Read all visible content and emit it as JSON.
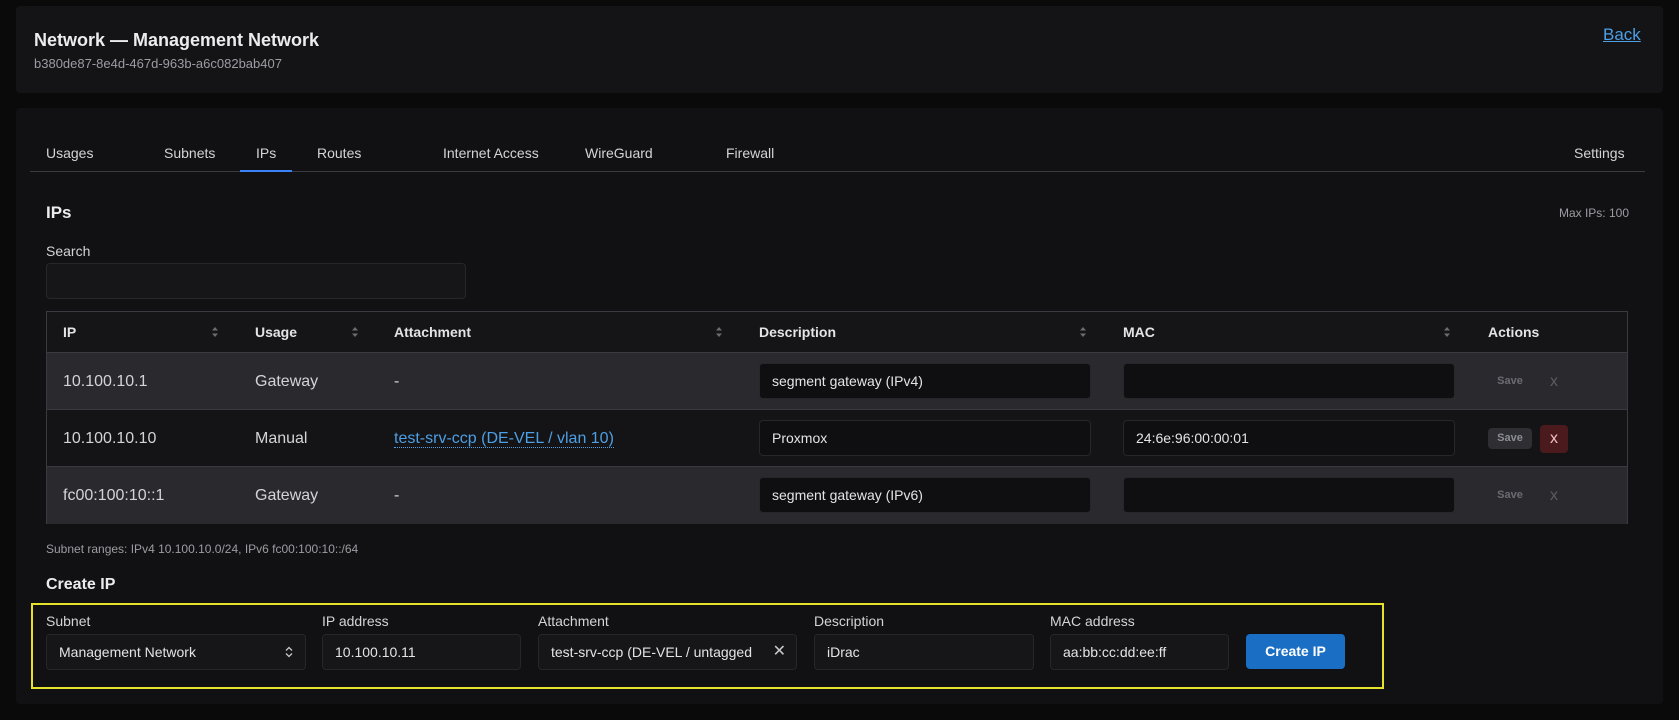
{
  "header": {
    "title": "Network — Management Network",
    "id": "b380de87-8e4d-467d-963b-a6c082bab407",
    "back_label": "Back"
  },
  "tabs": [
    {
      "label": "Usages"
    },
    {
      "label": "Subnets"
    },
    {
      "label": "IPs",
      "active": true
    },
    {
      "label": "Routes"
    },
    {
      "label": "Internet Access"
    },
    {
      "label": "WireGuard"
    },
    {
      "label": "Firewall"
    },
    {
      "label": "Settings"
    }
  ],
  "ips": {
    "title": "IPs",
    "max_ips": "Max IPs: 100",
    "search_label": "Search",
    "search_value": "",
    "columns": [
      "IP",
      "Usage",
      "Attachment",
      "Description",
      "MAC",
      "Actions"
    ],
    "rows": [
      {
        "ip": "10.100.10.1",
        "usage": "Gateway",
        "attachment": "-",
        "description": "segment gateway (IPv4)",
        "mac": "",
        "save": "Save",
        "delete": "x"
      },
      {
        "ip": "10.100.10.10",
        "usage": "Manual",
        "attachment": "test-srv-ccp (DE-VEL / vlan 10)",
        "description": "Proxmox",
        "mac": "24:6e:96:00:00:01",
        "save": "Save",
        "delete": "x"
      },
      {
        "ip": "fc00:100:10::1",
        "usage": "Gateway",
        "attachment": "-",
        "description": "segment gateway (IPv6)",
        "mac": "",
        "save": "Save",
        "delete": "x"
      }
    ],
    "subnet_ranges": "Subnet ranges: IPv4 10.100.10.0/24, IPv6 fc00:100:10::/64"
  },
  "create": {
    "title": "Create IP",
    "subnet_label": "Subnet",
    "subnet_value": "Management Network",
    "ip_label": "IP address",
    "ip_value": "10.100.10.11",
    "attachment_label": "Attachment",
    "attachment_value": "test-srv-ccp (DE-VEL / untagged",
    "description_label": "Description",
    "description_value": "iDrac",
    "mac_label": "MAC address",
    "mac_value": "aa:bb:cc:dd:ee:ff",
    "button_label": "Create IP"
  },
  "colors": {
    "accent": "#3b82f6",
    "link": "#4d9fe6",
    "create_button": "#1a6fc4",
    "highlight_border": "#e6e12a",
    "delete_active": "#4a1a1c"
  }
}
